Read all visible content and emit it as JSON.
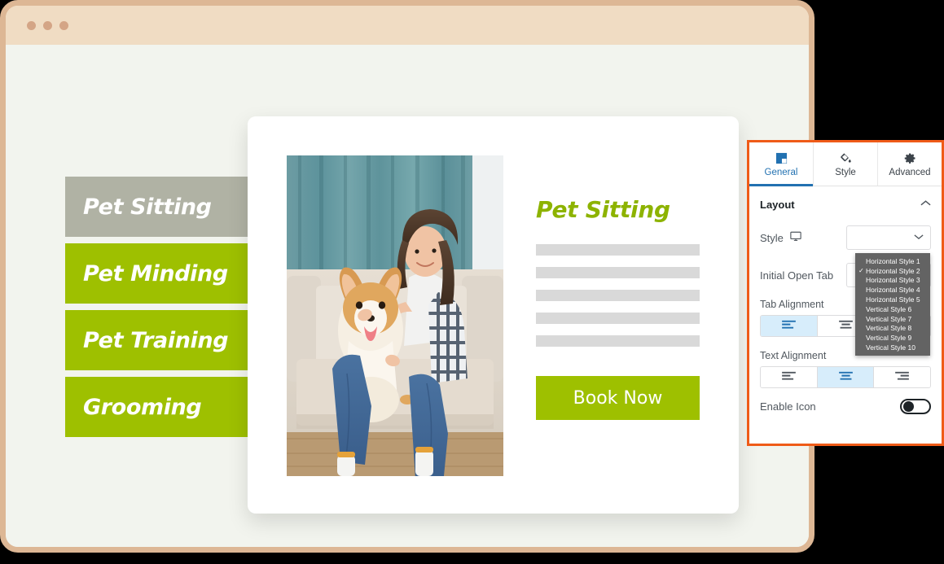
{
  "browser": {
    "traffic_lights": [
      "dot-red",
      "dot-yellow",
      "dot-green"
    ]
  },
  "tabs_widget": {
    "items": [
      {
        "label": "Pet Sitting",
        "active": true
      },
      {
        "label": "Pet Minding",
        "active": false
      },
      {
        "label": "Pet Training",
        "active": false
      },
      {
        "label": "Grooming",
        "active": false
      }
    ],
    "active_color": "#b0b2a4",
    "inactive_color": "#9ec000"
  },
  "content": {
    "title": "Pet Sitting",
    "photo_alt": "Woman holding a corgi dog on a sofa",
    "placeholder_lines": 5,
    "cta_label": "Book Now",
    "title_color": "#8db300",
    "cta_color": "#9ec000"
  },
  "settings_panel": {
    "accent_color": "#ef5b18",
    "tabs": [
      {
        "label": "General",
        "icon": "layout-icon",
        "active": true
      },
      {
        "label": "Style",
        "icon": "paint-bucket-icon",
        "active": false
      },
      {
        "label": "Advanced",
        "icon": "gear-icon",
        "active": false
      }
    ],
    "section": {
      "title": "Layout",
      "collapse_icon": "chevron-up-icon"
    },
    "fields": [
      {
        "label": "Style",
        "icon": "desktop-icon",
        "value": "",
        "control": "select"
      },
      {
        "label": "Initial Open Tab",
        "icon": "",
        "value": "",
        "control": "select"
      }
    ],
    "dropdown": {
      "selected": "Horizontal Style 2",
      "options": [
        "Horizontal Style 1",
        "Horizontal Style 2",
        "Horizontal Style 3",
        "Horizontal Style 4",
        "Horizontal Style 5",
        "Vertical Style 6",
        "Vertical Style 7",
        "Vertical Style 8",
        "Vertical Style 9",
        "Vertical Style 10"
      ]
    },
    "tab_alignment": {
      "label": "Tab Alignment",
      "options": [
        "align-left-icon",
        "align-center-icon",
        "align-right-icon"
      ],
      "selected_index": 0
    },
    "text_alignment": {
      "label": "Text Alignment",
      "options": [
        "align-left-icon",
        "align-center-icon",
        "align-right-icon"
      ],
      "selected_index": 1
    },
    "enable_icon": {
      "label": "Enable Icon",
      "value": "off"
    }
  }
}
